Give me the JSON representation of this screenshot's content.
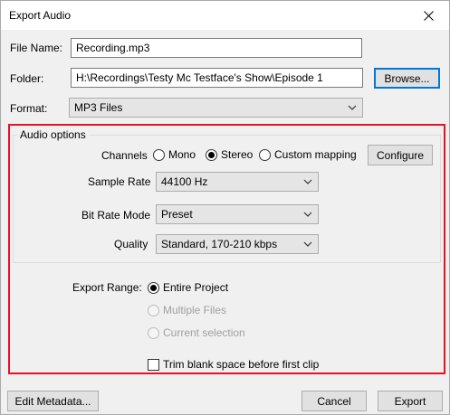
{
  "window": {
    "title": "Export Audio",
    "close_icon": "close-icon"
  },
  "file_name": {
    "label": "File Name:",
    "value": "Recording.mp3"
  },
  "folder": {
    "label": "Folder:",
    "value": "H:\\Recordings\\Testy Mc Testface's Show\\Episode 1",
    "browse_label": "Browse..."
  },
  "format": {
    "label": "Format:",
    "value": "MP3 Files"
  },
  "audio_options": {
    "title": "Audio options",
    "channels": {
      "label": "Channels",
      "options": [
        "Mono",
        "Stereo",
        "Custom mapping"
      ],
      "selected": "Stereo",
      "configure_label": "Configure"
    },
    "sample_rate": {
      "label": "Sample Rate",
      "value": "44100 Hz"
    },
    "bit_rate_mode": {
      "label": "Bit Rate Mode",
      "value": "Preset"
    },
    "quality": {
      "label": "Quality",
      "value": "Standard, 170-210 kbps"
    }
  },
  "export_range": {
    "label": "Export Range:",
    "options": [
      "Entire Project",
      "Multiple Files",
      "Current selection"
    ],
    "selected": "Entire Project"
  },
  "trim": {
    "label": "Trim blank space before first clip",
    "checked": false
  },
  "footer": {
    "edit_metadata_label": "Edit Metadata...",
    "cancel_label": "Cancel",
    "export_label": "Export"
  },
  "colors": {
    "highlight": "#e81123",
    "accent": "#0078d7"
  }
}
